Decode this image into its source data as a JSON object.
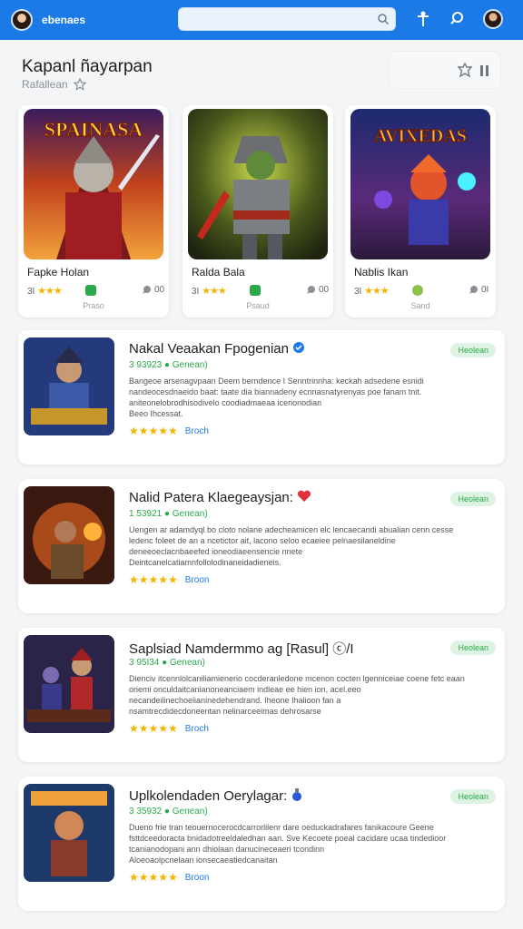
{
  "topbar": {
    "app_name": "ebenaes",
    "search_placeholder": "",
    "accent": "#1b7ae6"
  },
  "header": {
    "title": "Kapanl ñayarpan",
    "subtitle": "Rafallean"
  },
  "featured": [
    {
      "name": "Fapke Holan",
      "rating_prefix": "3I",
      "count": "00",
      "footer": "Praso",
      "art_title": "SPAINASA",
      "badge_color": "#2ba84a"
    },
    {
      "name": "Ralda Bala",
      "rating_prefix": "3I",
      "count": "00",
      "footer": "Psaud",
      "art_title": "",
      "badge_color": "#2ba84a"
    },
    {
      "name": "Nablis Ikan",
      "rating_prefix": "3I",
      "count": "0I",
      "footer": "Sand",
      "art_title": "AVIXEDAS",
      "badge_color": "#8bc34a"
    }
  ],
  "list": [
    {
      "title": "Nakal Veaakan Fpogenian",
      "meta": "3 93923 ● Genean)",
      "desc": "Bangeoe arsenagvpaan Deem berndence I Senntrinnha: keckah adsedene esnidi nandeocesdnaeido baat: taate dia biannadeny ecnnasnatyrenyas poe fanam tnit. aniteonelobrodhisodivelo coodiadmaeaa icerionodian",
      "desc2": "Beeo Ihcessat.",
      "pill": "Heolean",
      "link": "Broch",
      "icon": "verified-badge"
    },
    {
      "title": "Nalid Patera Klaegeaysjan:",
      "meta": "1 53921 ● Genean)",
      "desc": "Uengen ar adamdyql bo cloto nolane adecheamicen elc lencaecandi abualian cenn cesse ledenc foleet de an a ncetictor ait, lacono seloo ecaeiee pelnaesilaneldine deneeoeclacnbaeefed ioneodiaeensencie nnete",
      "desc2": "Deintcanelcatiamnfollolodinaneidadieneis.",
      "pill": "Heolean",
      "link": "Broon",
      "icon": "heart"
    },
    {
      "title": "Saplsiad Namdermmo ag [Rasul] ⓒ/I",
      "meta": "3 95I34 ● Genean)",
      "desc": "Dienciv itcennlolcaniliamienerio cocderanledone mcenon cocten lgenniceiae coene fetc eaan oriemi onculdaitcanianoneanciaem indleae ee hien ion, acel.eeo necandeilinechoelianinedehendrand. Iheone Ihalioon fan a",
      "desc2": "nsamtrecdidecdoneentan nelinarceeimas dehrosarse",
      "pill": "Heolean",
      "link": "Broch",
      "icon": ""
    },
    {
      "title": "Uplkolendaden Oerylagar:",
      "meta": "3 35932 ● Genean)",
      "desc": "Dueno frie tran teouernocerocdcarrorlilenr dare oeduckadrafares fanikacoure Geene fsttdceedoracta bnidadotreeldaledhan aan. Sve Kecoete poeal cacidare ucaa tindedioor tcanianodopani ann dhiolaan danucineceaeri tcondinn",
      "desc2": "Aloeoaolpcnelaan ionsecaeatiedcanaitan",
      "pill": "Heolean",
      "link": "Broon",
      "icon": "potion"
    }
  ]
}
